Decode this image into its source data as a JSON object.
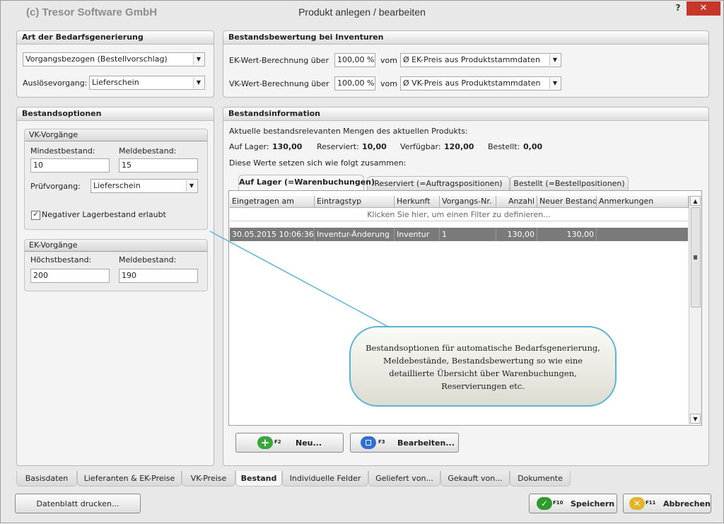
{
  "window": {
    "company": "(c) Tresor Software GmbH",
    "title": "Produkt anlegen / bearbeiten",
    "help": "?",
    "close": "✕"
  },
  "bedarf": {
    "title": "Art der Bedarfsgenerierung",
    "type_value": "Vorgangsbezogen (Bestellvorschlag)",
    "trigger_label": "Auslösevorgang:",
    "trigger_value": "Lieferschein"
  },
  "bewertung": {
    "title": "Bestandsbewertung bei Inventuren",
    "ek_label": "EK-Wert-Berechnung über",
    "ek_percent": "100,00 %",
    "ek_vom": "vom",
    "ek_source": "Ø EK-Preis aus Produktstammdaten",
    "vk_label": "VK-Wert-Berechnung über",
    "vk_percent": "100,00 %",
    "vk_vom": "vom",
    "vk_source": "Ø VK-Preis aus Produktstammdaten"
  },
  "optionen": {
    "title": "Bestandsoptionen",
    "vk": {
      "title": "VK-Vorgänge",
      "min_label": "Mindestbestand:",
      "min_value": "10",
      "melde_label": "Meldebestand:",
      "melde_value": "15",
      "pruef_label": "Prüfvorgang:",
      "pruef_value": "Lieferschein",
      "negative_label": "Negativer Lagerbestand erlaubt",
      "negative_checked": true
    },
    "ek": {
      "title": "EK-Vorgänge",
      "max_label": "Höchstbestand:",
      "max_value": "200",
      "melde_label": "Meldebestand:",
      "melde_value": "190"
    }
  },
  "info": {
    "title": "Bestandsinformation",
    "intro": "Aktuelle bestandsrelevanten Mengen des aktuellen Produkts:",
    "lager_label": "Auf Lager:",
    "lager_value": "130,00",
    "reserviert_label": "Reserviert:",
    "reserviert_value": "10,00",
    "verfuegbar_label": "Verfügbar:",
    "verfuegbar_value": "120,00",
    "bestellt_label": "Bestellt:",
    "bestellt_value": "0,00",
    "composition": "Diese Werte setzen sich wie folgt zusammen:",
    "tabs": [
      "Auf Lager (=Warenbuchungen)",
      "Reserviert (=Auftragspositionen)",
      "Bestellt (=Bestellpositionen)"
    ],
    "columns": [
      "Eingetragen am",
      "Eintragstyp",
      "Herkunft",
      "Vorgangs-Nr.",
      "Anzahl",
      "Neuer Bestand",
      "Anmerkungen"
    ],
    "filter_hint": "Klicken Sie hier, um einen Filter zu definieren...",
    "rows": [
      [
        "30.05.2015 10:06:36",
        "Inventur-Änderung",
        "Inventur",
        "1",
        "130,00",
        "130,00",
        ""
      ]
    ],
    "btn_new": "Neu...",
    "btn_new_key": "F2",
    "btn_edit": "Bearbeiten...",
    "btn_edit_key": "F3"
  },
  "callout": {
    "line1": "Bestandsoptionen für automatische Bedarfsgenerierung,",
    "line2": "Meldebestände, Bestandsbewertung so wie eine",
    "line3": "detaillierte Übersicht über Warenbuchungen,",
    "line4": "Reservierungen etc."
  },
  "bottom_tabs": [
    "Basisdaten",
    "Lieferanten & EK-Preise",
    "VK-Preise",
    "Bestand",
    "Individuelle Felder",
    "Geliefert von...",
    "Gekauft von...",
    "Dokumente"
  ],
  "footer": {
    "datasheet": "Datenblatt drucken...",
    "save": "Speichern",
    "save_key": "F10",
    "cancel": "Abbrechen",
    "cancel_key": "F11"
  },
  "colors": {
    "selection": "#7a7a7a",
    "close_button": "#c7352b",
    "callout_border": "#5ab3d8",
    "save_icon": "#2e9b2e",
    "cancel_icon": "#e3b52a",
    "new_icon": "#3aa53a",
    "edit_icon": "#2f6fd1"
  }
}
